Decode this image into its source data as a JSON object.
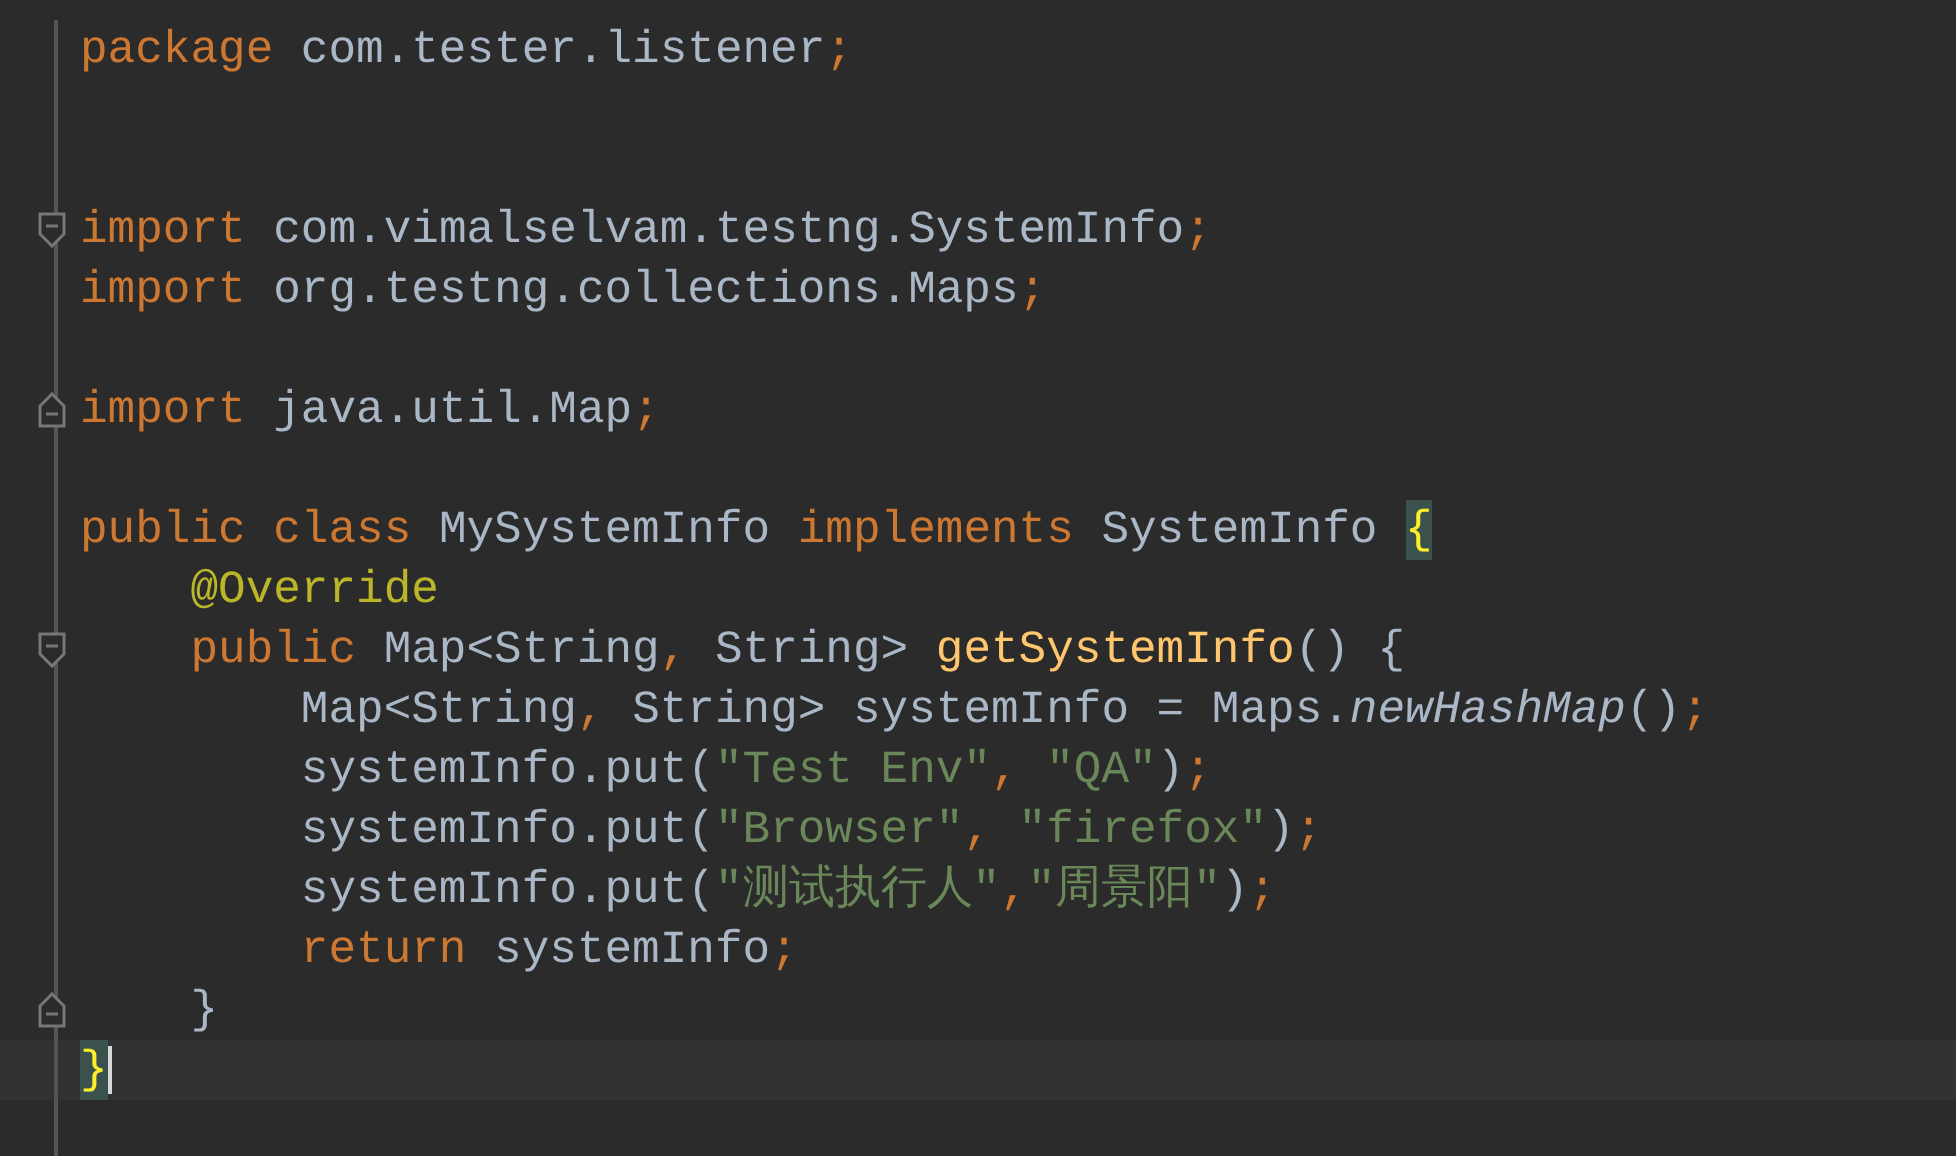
{
  "editor": {
    "lines": [
      {
        "kind": "code",
        "current": false,
        "tokens": [
          {
            "kind": "keyword",
            "text": "package "
          },
          {
            "kind": "plain",
            "text": "com.tester.listener"
          },
          {
            "kind": "punct",
            "text": ";"
          }
        ]
      },
      {
        "kind": "blank"
      },
      {
        "kind": "blank"
      },
      {
        "kind": "code",
        "current": false,
        "fold_start": true,
        "tokens": [
          {
            "kind": "keyword",
            "text": "import "
          },
          {
            "kind": "plain",
            "text": "com.vimalselvam.testng.SystemInfo"
          },
          {
            "kind": "punct",
            "text": ";"
          }
        ]
      },
      {
        "kind": "code",
        "current": false,
        "tokens": [
          {
            "kind": "keyword",
            "text": "import "
          },
          {
            "kind": "plain",
            "text": "org.testng.collections.Maps"
          },
          {
            "kind": "punct",
            "text": ";"
          }
        ]
      },
      {
        "kind": "blank"
      },
      {
        "kind": "code",
        "current": false,
        "fold_end": true,
        "tokens": [
          {
            "kind": "keyword",
            "text": "import "
          },
          {
            "kind": "plain",
            "text": "java.util.Map"
          },
          {
            "kind": "punct",
            "text": ";"
          }
        ]
      },
      {
        "kind": "blank"
      },
      {
        "kind": "code",
        "current": false,
        "tokens": [
          {
            "kind": "keyword",
            "text": "public class "
          },
          {
            "kind": "plain",
            "text": "MySystemInfo "
          },
          {
            "kind": "keyword",
            "text": "implements "
          },
          {
            "kind": "plain",
            "text": "SystemInfo "
          },
          {
            "kind": "brace-match",
            "text": "{"
          }
        ]
      },
      {
        "kind": "code",
        "current": false,
        "tokens": [
          {
            "kind": "annotation",
            "text": "    @Override"
          }
        ]
      },
      {
        "kind": "code",
        "current": false,
        "fold_start": true,
        "tokens": [
          {
            "kind": "keyword",
            "text": "    public "
          },
          {
            "kind": "plain",
            "text": "Map<String"
          },
          {
            "kind": "punct",
            "text": ", "
          },
          {
            "kind": "plain",
            "text": "String> "
          },
          {
            "kind": "method",
            "text": "getSystemInfo"
          },
          {
            "kind": "plain",
            "text": "() {"
          }
        ]
      },
      {
        "kind": "code",
        "current": false,
        "tokens": [
          {
            "kind": "plain",
            "text": "        Map<String"
          },
          {
            "kind": "punct",
            "text": ", "
          },
          {
            "kind": "plain",
            "text": "String> systemInfo = Maps."
          },
          {
            "kind": "static",
            "text": "newHashMap"
          },
          {
            "kind": "plain",
            "text": "()"
          },
          {
            "kind": "punct",
            "text": ";"
          }
        ]
      },
      {
        "kind": "code",
        "current": false,
        "tokens": [
          {
            "kind": "plain",
            "text": "        systemInfo.put("
          },
          {
            "kind": "string",
            "text": "\"Test Env\""
          },
          {
            "kind": "punct",
            "text": ", "
          },
          {
            "kind": "string",
            "text": "\"QA\""
          },
          {
            "kind": "plain",
            "text": ")"
          },
          {
            "kind": "punct",
            "text": ";"
          }
        ]
      },
      {
        "kind": "code",
        "current": false,
        "tokens": [
          {
            "kind": "plain",
            "text": "        systemInfo.put("
          },
          {
            "kind": "string",
            "text": "\"Browser\""
          },
          {
            "kind": "punct",
            "text": ", "
          },
          {
            "kind": "string",
            "text": "\"firefox\""
          },
          {
            "kind": "plain",
            "text": ")"
          },
          {
            "kind": "punct",
            "text": ";"
          }
        ]
      },
      {
        "kind": "code",
        "current": false,
        "tokens": [
          {
            "kind": "plain",
            "text": "        systemInfo.put("
          },
          {
            "kind": "string",
            "text": "\"测试执行人\""
          },
          {
            "kind": "punct",
            "text": ","
          },
          {
            "kind": "string",
            "text": "\"周景阳\""
          },
          {
            "kind": "plain",
            "text": ")"
          },
          {
            "kind": "punct",
            "text": ";"
          }
        ]
      },
      {
        "kind": "code",
        "current": false,
        "tokens": [
          {
            "kind": "keyword",
            "text": "        return "
          },
          {
            "kind": "plain",
            "text": "systemInfo"
          },
          {
            "kind": "punct",
            "text": ";"
          }
        ]
      },
      {
        "kind": "code",
        "current": false,
        "fold_end": true,
        "tokens": [
          {
            "kind": "plain",
            "text": "    }"
          }
        ]
      },
      {
        "kind": "code",
        "current": true,
        "tokens": [
          {
            "kind": "brace-match",
            "text": "}"
          }
        ]
      },
      {
        "kind": "blank"
      }
    ]
  }
}
